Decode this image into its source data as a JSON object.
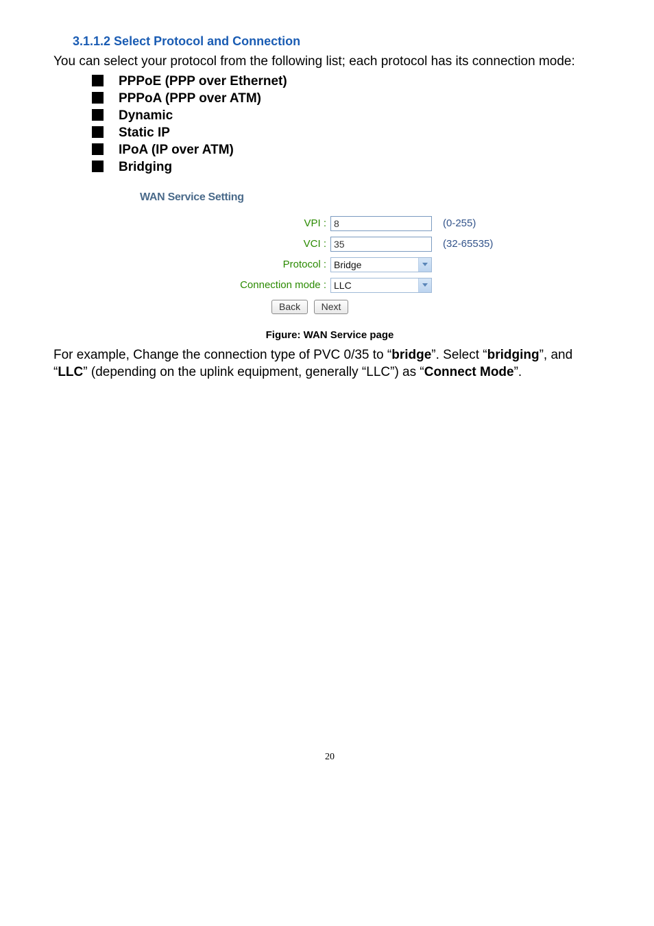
{
  "heading": "3.1.1.2 Select Protocol and Connection",
  "intro": "You can select your protocol from the following list; each protocol has its connection mode:",
  "bullets": [
    "PPPoE (PPP over Ethernet)",
    "PPPoA (PPP over ATM)",
    "Dynamic",
    "Static IP",
    "IPoA (IP over ATM)",
    "Bridging"
  ],
  "router": {
    "title": "WAN Service Setting",
    "rows": {
      "vpi_label": "VPI :",
      "vpi_value": "8",
      "vpi_hint": "(0-255)",
      "vci_label": "VCI :",
      "vci_value": "35",
      "vci_hint": "(32-65535)",
      "protocol_label": "Protocol :",
      "protocol_value": "Bridge",
      "mode_label": "Connection mode :",
      "mode_value": "LLC"
    },
    "buttons": {
      "back": "Back",
      "next": "Next"
    }
  },
  "figure_caption": "Figure: WAN Service page",
  "para2_a": "For example, Change the connection type of PVC 0/35 to “",
  "para2_bridge": "bridge",
  "para2_b": "”. Select “",
  "para2_bridging": "bridging",
  "para2_c": "”, and “",
  "para2_llc": "LLC",
  "para2_d": "” (depending on the uplink equipment, generally “LLC”) as “",
  "para2_cm": "Connect Mode",
  "para2_e": "”.",
  "page_number": "20"
}
